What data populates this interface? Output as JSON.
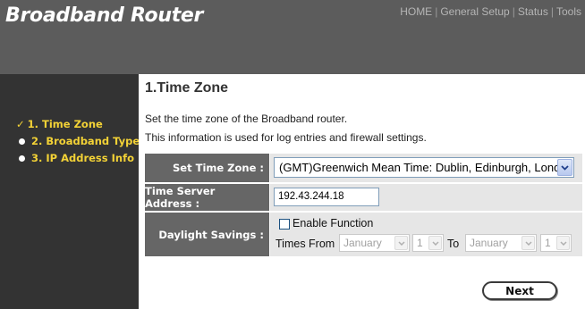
{
  "header": {
    "brand": "Broadband Router",
    "nav": [
      {
        "label": "HOME"
      },
      {
        "label": "General Setup"
      },
      {
        "label": "Status"
      },
      {
        "label": "Tools"
      }
    ],
    "separator": "|"
  },
  "sidebar": {
    "items": [
      {
        "label": "1. Time Zone",
        "state": "checked"
      },
      {
        "label": "2. Broadband Type",
        "state": "bullet"
      },
      {
        "label": "3. IP Address Info",
        "state": "bullet"
      }
    ]
  },
  "main": {
    "title": "1.Time Zone",
    "desc_line1": "Set the time zone of the Broadband router.",
    "desc_line2": "This information is used for log entries and firewall settings."
  },
  "form": {
    "timezone": {
      "label": "Set Time Zone :",
      "value": "(GMT)Greenwich Mean Time: Dublin, Edinburgh, London"
    },
    "time_server": {
      "label": "Time Server Address :",
      "value": "192.43.244.18"
    },
    "daylight": {
      "label": "Daylight Savings :",
      "checkbox_label": "Enable Function",
      "checked": false,
      "times_from": "Times From",
      "to": "To",
      "from_month": "January",
      "from_day": "1",
      "to_month": "January",
      "to_day": "1"
    }
  },
  "buttons": {
    "next": "Next"
  },
  "colors": {
    "header_bg": "#5c5c5c",
    "sidebar_bg": "#333333",
    "sidebar_text": "#f3d236",
    "label_cell_bg": "#666666",
    "value_cell_bg": "#e6e6e6"
  }
}
